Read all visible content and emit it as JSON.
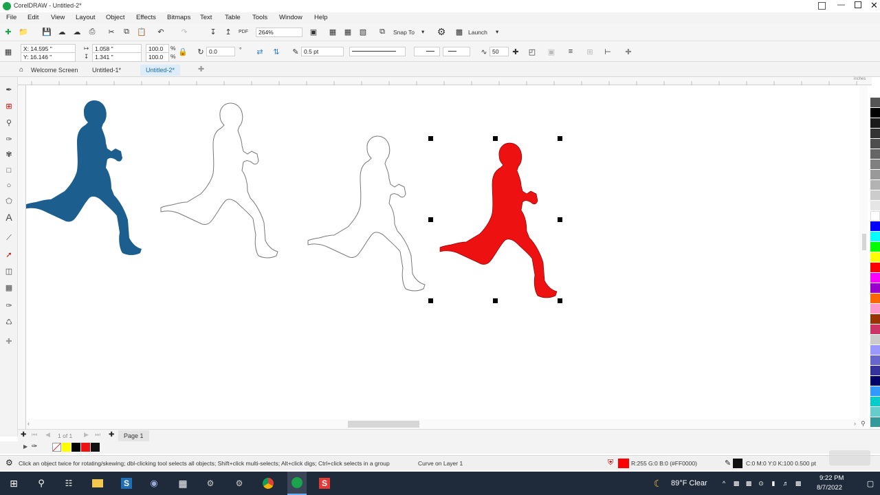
{
  "window": {
    "title": "CorelDRAW - Untitled-2*"
  },
  "menu": [
    "File",
    "Edit",
    "View",
    "Layout",
    "Object",
    "Effects",
    "Bitmaps",
    "Text",
    "Table",
    "Tools",
    "Window",
    "Help"
  ],
  "standard_toolbar": {
    "zoom": "264%",
    "snap_to": "Snap To",
    "launch": "Launch"
  },
  "property_bar": {
    "x": "X: 14.595 \"",
    "y": "Y: 16.146 \"",
    "width": "1.058 \"",
    "height": "1.341 \"",
    "scale_x": "100.0",
    "scale_y": "100.0",
    "pct1": "%",
    "pct2": "%",
    "rotation": "0.0",
    "rotation_unit": "°",
    "outline_width": "0.5 pt",
    "smoothing": "50"
  },
  "tabs": [
    "Welcome Screen",
    "Untitled-1*",
    "Untitled-2*"
  ],
  "ruler": {
    "unit": "inches"
  },
  "page_nav": {
    "counter": "1 of 1",
    "page_label": "Page 1"
  },
  "status": {
    "hint": "Click an object twice for rotating/skewing; dbl-clicking tool selects all objects; Shift+click multi-selects; Alt+click digs; Ctrl+click selects in a group",
    "object_info": "Curve on Layer 1",
    "fill_info": "R:255 G:0 B:0 (#FF0000)",
    "outline_info": "C:0 M:0 Y:0 K:100  0.500 pt",
    "fill_color": "#ff0000",
    "outline_color": "#111111"
  },
  "taskbar": {
    "weather": "89°F  Clear",
    "time": "9:22 PM",
    "date": "8/7/2022"
  },
  "colors": {
    "blue_runner": "#1c5f8f",
    "red_runner": "#ee1111",
    "palette": [
      "#555555",
      "#000000",
      "#1a1a1a",
      "#333333",
      "#4d4d4d",
      "#666666",
      "#808080",
      "#999999",
      "#b3b3b3",
      "#cccccc",
      "#e6e6e6",
      "#ffffff",
      "#0000ff",
      "#00ffff",
      "#00ff00",
      "#ffff00",
      "#ff0000",
      "#ff00ff",
      "#9900cc",
      "#ff6600",
      "#ff99cc",
      "#993300",
      "#cc3366",
      "#cccccc",
      "#9999ff",
      "#6666cc",
      "#333399",
      "#000066",
      "#3399ff",
      "#00cccc",
      "#66cccc",
      "#339999"
    ]
  }
}
